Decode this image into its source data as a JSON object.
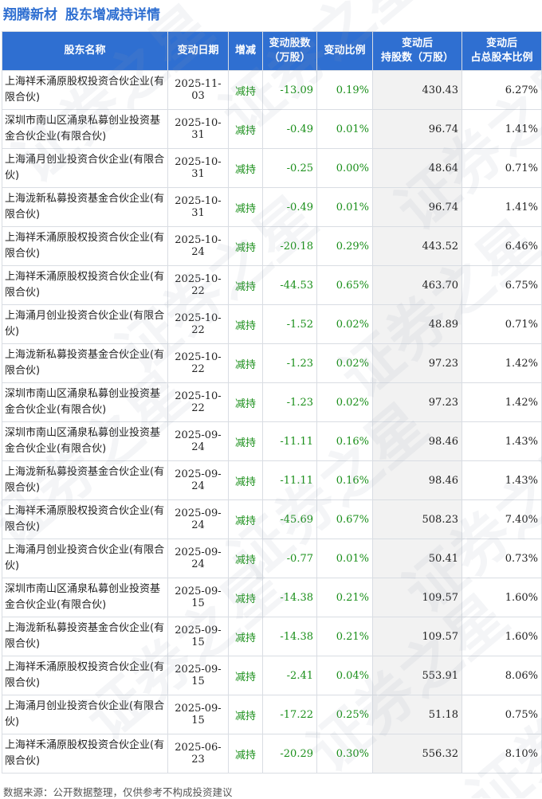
{
  "header": {
    "stock_name": "翔腾新材",
    "title": "股东增减持详情"
  },
  "colors": {
    "header_bg": "#2f6fd1",
    "title": "#2f6fd1",
    "decrease": "#1a8f1a",
    "shade": "#f2f2f2"
  },
  "table": {
    "columns": [
      "股东名称",
      "变动日期",
      "增减",
      "变动股数\n（万股）",
      "变动比例",
      "变动后\n持股数（万股）",
      "变动后\n占总股本比例"
    ],
    "rows": [
      {
        "name": "上海祥禾涌原股权投资合伙企业(有限合伙)",
        "date": "2025-11-03",
        "type": "减持",
        "change": "-13.09",
        "ratio": "0.19%",
        "after": "430.43",
        "pct": "6.27%"
      },
      {
        "name": "深圳市南山区涌泉私募创业投资基金合伙企业(有限合伙)",
        "date": "2025-10-31",
        "type": "减持",
        "change": "-0.49",
        "ratio": "0.01%",
        "after": "96.74",
        "pct": "1.41%"
      },
      {
        "name": "上海涌月创业投资合伙企业(有限合伙)",
        "date": "2025-10-31",
        "type": "减持",
        "change": "-0.25",
        "ratio": "0.00%",
        "after": "48.64",
        "pct": "0.71%"
      },
      {
        "name": "上海泷新私募投资基金合伙企业(有限合伙)",
        "date": "2025-10-31",
        "type": "减持",
        "change": "-0.49",
        "ratio": "0.01%",
        "after": "96.74",
        "pct": "1.41%"
      },
      {
        "name": "上海祥禾涌原股权投资合伙企业(有限合伙)",
        "date": "2025-10-24",
        "type": "减持",
        "change": "-20.18",
        "ratio": "0.29%",
        "after": "443.52",
        "pct": "6.46%"
      },
      {
        "name": "上海祥禾涌原股权投资合伙企业(有限合伙)",
        "date": "2025-10-22",
        "type": "减持",
        "change": "-44.53",
        "ratio": "0.65%",
        "after": "463.70",
        "pct": "6.75%"
      },
      {
        "name": "上海涌月创业投资合伙企业(有限合伙)",
        "date": "2025-10-22",
        "type": "减持",
        "change": "-1.52",
        "ratio": "0.02%",
        "after": "48.89",
        "pct": "0.71%"
      },
      {
        "name": "上海泷新私募投资基金合伙企业(有限合伙)",
        "date": "2025-10-22",
        "type": "减持",
        "change": "-1.23",
        "ratio": "0.02%",
        "after": "97.23",
        "pct": "1.42%"
      },
      {
        "name": "深圳市南山区涌泉私募创业投资基金合伙企业(有限合伙)",
        "date": "2025-10-22",
        "type": "减持",
        "change": "-1.23",
        "ratio": "0.02%",
        "after": "97.23",
        "pct": "1.42%"
      },
      {
        "name": "深圳市南山区涌泉私募创业投资基金合伙企业(有限合伙)",
        "date": "2025-09-24",
        "type": "减持",
        "change": "-11.11",
        "ratio": "0.16%",
        "after": "98.46",
        "pct": "1.43%"
      },
      {
        "name": "上海泷新私募投资基金合伙企业(有限合伙)",
        "date": "2025-09-24",
        "type": "减持",
        "change": "-11.11",
        "ratio": "0.16%",
        "after": "98.46",
        "pct": "1.43%"
      },
      {
        "name": "上海祥禾涌原股权投资合伙企业(有限合伙)",
        "date": "2025-09-24",
        "type": "减持",
        "change": "-45.69",
        "ratio": "0.67%",
        "after": "508.23",
        "pct": "7.40%"
      },
      {
        "name": "上海涌月创业投资合伙企业(有限合伙)",
        "date": "2025-09-24",
        "type": "减持",
        "change": "-0.77",
        "ratio": "0.01%",
        "after": "50.41",
        "pct": "0.73%"
      },
      {
        "name": "深圳市南山区涌泉私募创业投资基金合伙企业(有限合伙)",
        "date": "2025-09-15",
        "type": "减持",
        "change": "-14.38",
        "ratio": "0.21%",
        "after": "109.57",
        "pct": "1.60%"
      },
      {
        "name": "上海泷新私募投资基金合伙企业(有限合伙)",
        "date": "2025-09-15",
        "type": "减持",
        "change": "-14.38",
        "ratio": "0.21%",
        "after": "109.57",
        "pct": "1.60%"
      },
      {
        "name": "上海祥禾涌原股权投资合伙企业(有限合伙)",
        "date": "2025-09-15",
        "type": "减持",
        "change": "-2.41",
        "ratio": "0.04%",
        "after": "553.91",
        "pct": "8.06%"
      },
      {
        "name": "上海涌月创业投资合伙企业(有限合伙)",
        "date": "2025-09-15",
        "type": "减持",
        "change": "-17.22",
        "ratio": "0.25%",
        "after": "51.18",
        "pct": "0.75%"
      },
      {
        "name": "上海祥禾涌原股权投资合伙企业(有限合伙)",
        "date": "2025-06-23",
        "type": "减持",
        "change": "-20.29",
        "ratio": "0.30%",
        "after": "556.32",
        "pct": "8.10%"
      }
    ]
  },
  "watermark": {
    "text": "证券之星"
  },
  "footer": {
    "source": "数据来源：公开数据整理，仅供参考不构成投资建议"
  }
}
